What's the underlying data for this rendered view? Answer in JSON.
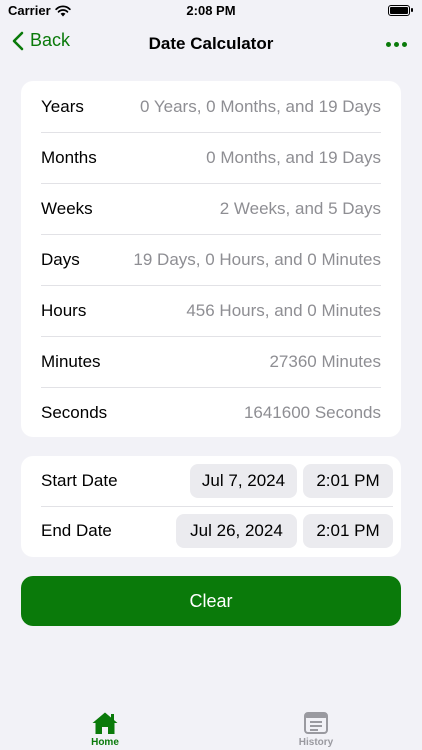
{
  "status": {
    "carrier": "Carrier",
    "time": "2:08 PM"
  },
  "nav": {
    "back_label": "Back",
    "title": "Date Calculator"
  },
  "results": [
    {
      "label": "Years",
      "value": "0 Years, 0 Months, and 19 Days"
    },
    {
      "label": "Months",
      "value": "0 Months, and 19 Days"
    },
    {
      "label": "Weeks",
      "value": "2 Weeks, and 5 Days"
    },
    {
      "label": "Days",
      "value": "19 Days, 0 Hours, and 0 Minutes"
    },
    {
      "label": "Hours",
      "value": "456 Hours, and 0 Minutes"
    },
    {
      "label": "Minutes",
      "value": "27360 Minutes"
    },
    {
      "label": "Seconds",
      "value": "1641600 Seconds"
    }
  ],
  "dates": {
    "start": {
      "label": "Start Date",
      "date": "Jul 7, 2024",
      "time": "2:01 PM"
    },
    "end": {
      "label": "End Date",
      "date": "Jul 26, 2024",
      "time": "2:01 PM"
    }
  },
  "clear_label": "Clear",
  "tabs": [
    {
      "label": "Home",
      "icon": "home-icon",
      "selected": true
    },
    {
      "label": "History",
      "icon": "history-icon",
      "selected": false
    }
  ],
  "colors": {
    "accent": "#0a7a0a",
    "background": "#f2f2f7"
  }
}
